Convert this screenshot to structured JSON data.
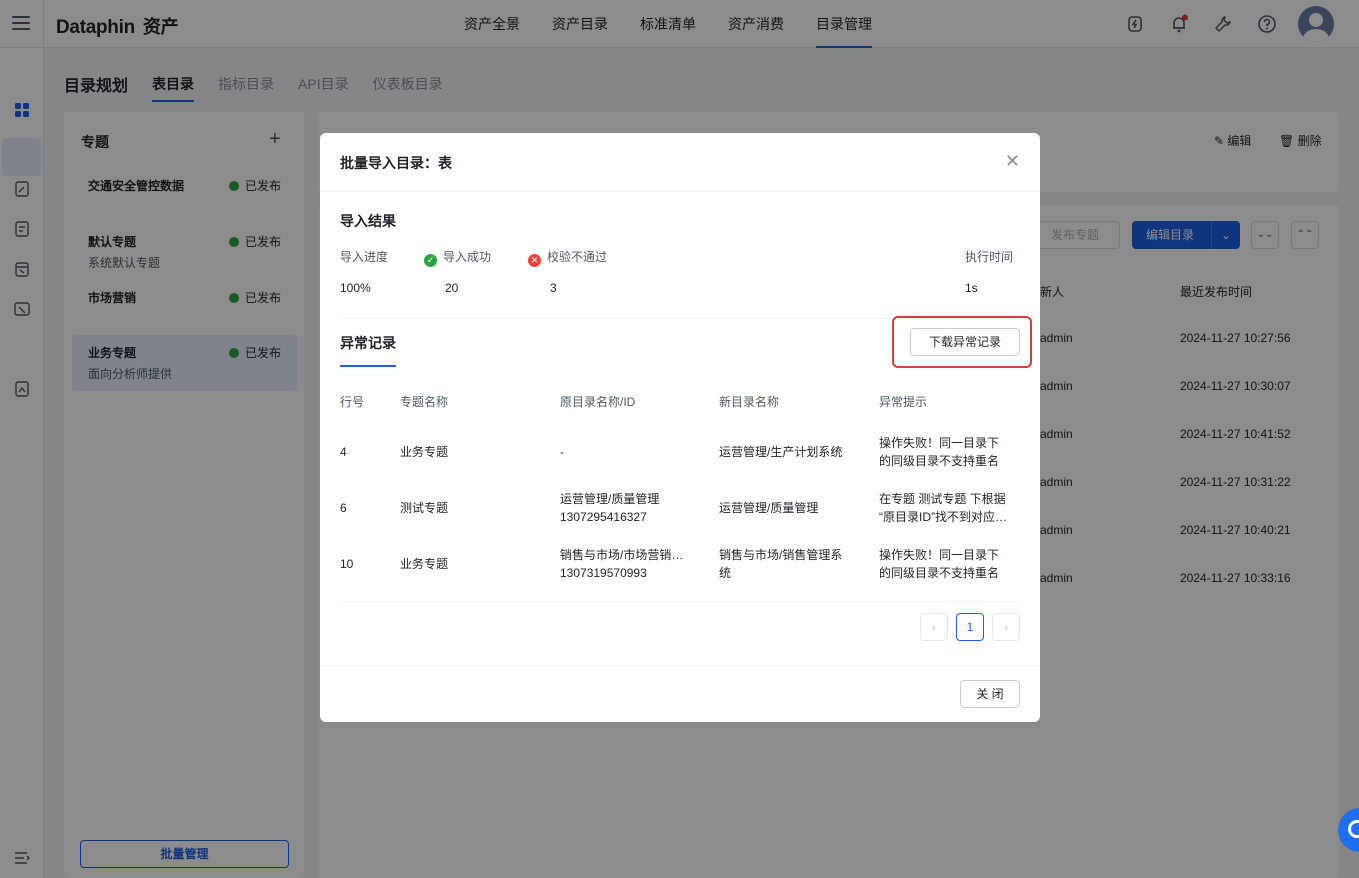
{
  "app": {
    "logo": "Dataphin",
    "logo_sub": "资产"
  },
  "nav": [
    "资产全景",
    "资产目录",
    "标准清单",
    "资产消费",
    "目录管理"
  ],
  "nav_active": "目录管理",
  "subtabs": {
    "title": "目录规划",
    "tabs": [
      "表目录",
      "指标目录",
      "API目录",
      "仪表板目录"
    ],
    "active": "表目录"
  },
  "left_panel": {
    "title": "专题",
    "topics": [
      {
        "name": "交通安全管控数据",
        "desc": "",
        "status": "已发布"
      },
      {
        "name": "默认专题",
        "desc": "系统默认专题",
        "status": "已发布"
      },
      {
        "name": "市场营销",
        "desc": "",
        "status": "已发布"
      },
      {
        "name": "业务专题",
        "desc": "面向分析师提供",
        "status": "已发布"
      }
    ],
    "batch_button": "批量管理"
  },
  "main": {
    "edit": "编辑",
    "delete": "删除",
    "publish_topic": "发布专题",
    "edit_catalog": "编辑目录",
    "col_updater": "新人",
    "col_time": "最近发布时间",
    "rows": [
      {
        "user": "admin",
        "time": "2024-11-27 10:27:56"
      },
      {
        "user": "admin",
        "time": "2024-11-27 10:30:07"
      },
      {
        "user": "admin",
        "time": "2024-11-27 10:41:52"
      },
      {
        "user": "admin",
        "time": "2024-11-27 10:31:22"
      },
      {
        "user": "admin",
        "time": "2024-11-27 10:40:21"
      },
      {
        "user": "admin",
        "time": "2024-11-27 10:33:16"
      }
    ]
  },
  "modal": {
    "title": "批量导入目录：表",
    "result_title": "导入结果",
    "labels": {
      "progress": "导入进度",
      "success": "导入成功",
      "failed": "校验不通过",
      "time": "执行时间"
    },
    "values": {
      "progress": "100%",
      "success": "20",
      "failed": "3",
      "time": "1s"
    },
    "anomaly_tab": "异常记录",
    "download_button": "下载异常记录",
    "columns": [
      "行号",
      "专题名称",
      "原目录名称/ID",
      "新目录名称",
      "异常提示"
    ],
    "rows": [
      {
        "line": "4",
        "topic": "业务专题",
        "orig": "-",
        "orig_id": "",
        "new": "运营管理/生产计划系统",
        "new2": "",
        "msg": "操作失败！同一目录下",
        "msg2": "的同级目录不支持重名"
      },
      {
        "line": "6",
        "topic": "测试专题",
        "orig": "运营管理/质量管理",
        "orig_id": "1307295416327",
        "new": "运营管理/质量管理",
        "new2": "",
        "msg": "在专题 测试专题 下根据",
        "msg2": "“原目录ID”找不到对应…"
      },
      {
        "line": "10",
        "topic": "业务专题",
        "orig": "销售与市场/市场营销…",
        "orig_id": "1307319570993",
        "new": "销售与市场/销售管理系",
        "new2": "统",
        "msg": "操作失败！同一目录下",
        "msg2": "的同级目录不支持重名"
      }
    ],
    "page": "1",
    "close_button": "关 闭"
  }
}
